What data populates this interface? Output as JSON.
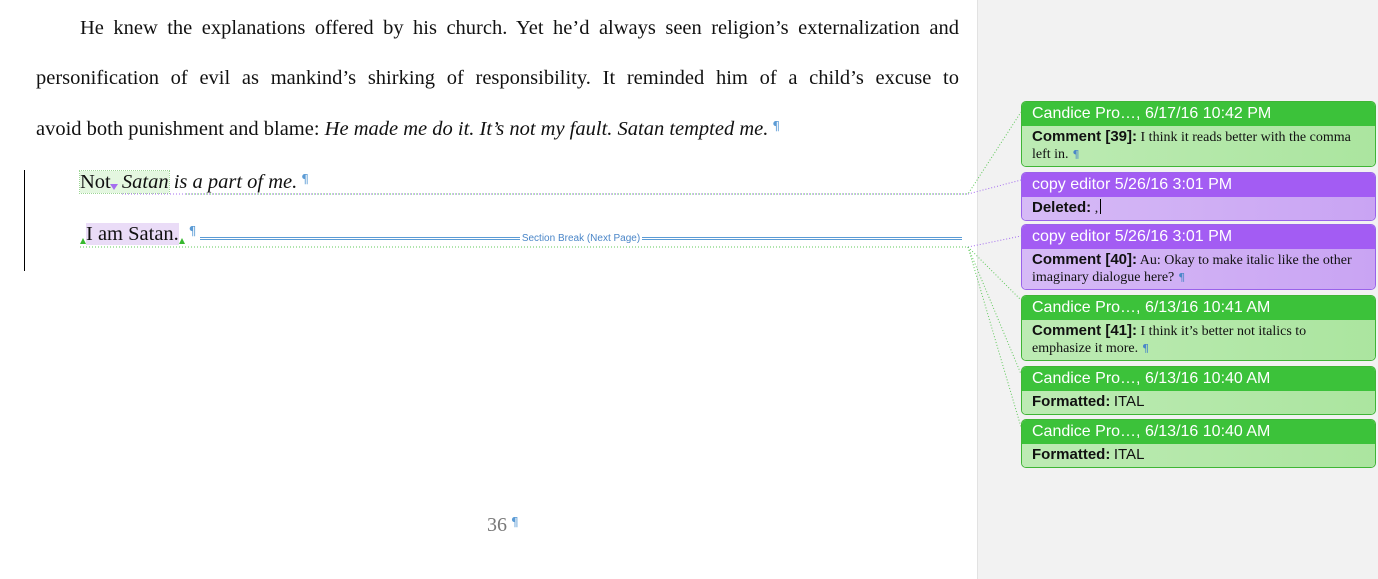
{
  "document": {
    "paragraph1": [
      "He knew the explanations offered by his church. Yet he’d always seen religion’s externalization and",
      "personification of evil as mankind’s shirking of responsibility. It reminded him of a child’s excuse to"
    ],
    "paragraph1_last_plain": "avoid both punishment and blame: ",
    "paragraph1_last_italic": "He made me do it. It’s not my fault. Satan tempted me.",
    "line4_not": "Not",
    "line4_deleted_comma": ",",
    "line4_space": " ",
    "line4_satan": "Satan",
    "line4_rest": " is a part of me.",
    "line5_text": "I am Satan.",
    "pilcrow": "¶",
    "section_break_label": "Section Break (Next Page)",
    "page_number": "36"
  },
  "balloons": [
    {
      "header": "Candice Pro…, 6/17/16 10:42 PM",
      "kind": "Comment [39]:",
      "text": "I think it reads better with the comma left in.",
      "color": "green"
    },
    {
      "header": "copy editor 5/26/16 3:01 PM",
      "kind": "Deleted:",
      "text": ",",
      "color": "purple"
    },
    {
      "header": "copy editor 5/26/16 3:01 PM",
      "kind": "Comment [40]:",
      "text": "Au: Okay to make italic like the other imaginary dialogue here?",
      "color": "purple"
    },
    {
      "header": "Candice Pro…, 6/13/16 10:41 AM",
      "kind": "Comment [41]:",
      "text": "I think it’s better not italics to emphasize it more.",
      "color": "green"
    },
    {
      "header": "Candice Pro…, 6/13/16 10:40 AM",
      "kind": "Formatted:",
      "text": "ITAL",
      "color": "green"
    },
    {
      "header": "Candice Pro…, 6/13/16 10:40 AM",
      "kind": "Formatted:",
      "text": "ITAL",
      "color": "green"
    }
  ],
  "colors": {
    "green_balloon": "#3cc23a",
    "purple_balloon": "#a35cf3",
    "pilcrow": "#5b9bd5"
  }
}
